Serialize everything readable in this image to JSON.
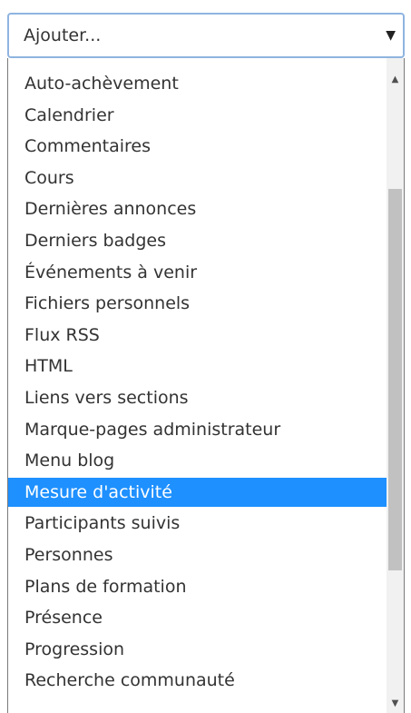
{
  "select": {
    "value": "Ajouter...",
    "arrow_icon": "▼"
  },
  "list": {
    "selected_index": 13,
    "options": [
      "Auto-achèvement",
      "Calendrier",
      "Commentaires",
      "Cours",
      "Dernières annonces",
      "Derniers badges",
      "Événements à venir",
      "Fichiers personnels",
      "Flux RSS",
      "HTML",
      "Liens vers sections",
      "Marque-pages administrateur",
      "Menu blog",
      "Mesure d'activité",
      "Participants suivis",
      "Personnes",
      "Plans de formation",
      "Présence",
      "Progression",
      "Recherche communauté"
    ]
  },
  "scrollbar": {
    "up_icon": "▲",
    "down_icon": "▼"
  },
  "colors": {
    "selected_bg": "#1e90ff",
    "select_border": "#8fb4e0"
  }
}
